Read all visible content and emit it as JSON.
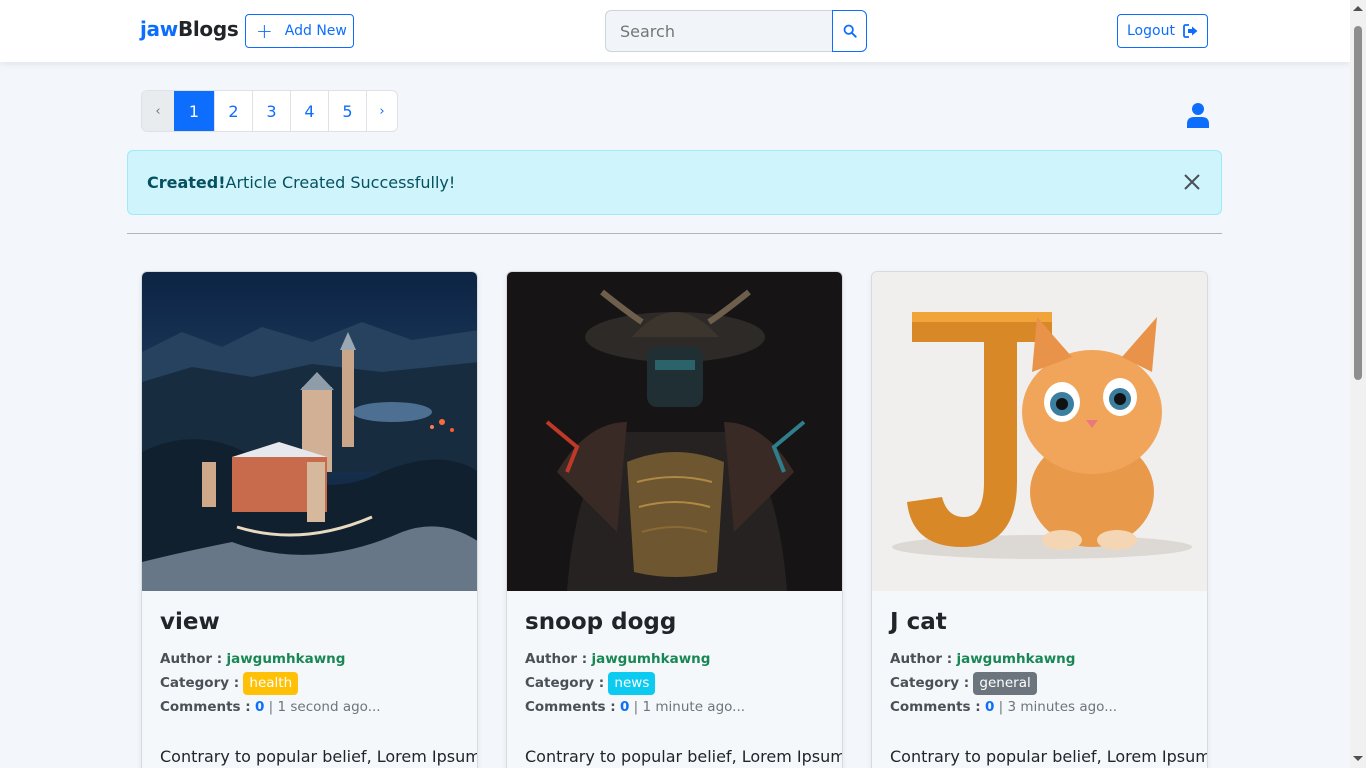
{
  "navbar": {
    "brand_part1": "jaw",
    "brand_part2": "Blogs",
    "add_new_label": "Add New",
    "search_placeholder": "Search",
    "logout_label": "Logout"
  },
  "pagination": {
    "prev": "‹",
    "pages": [
      "1",
      "2",
      "3",
      "4",
      "5"
    ],
    "active_page": "1",
    "next": "›"
  },
  "alert": {
    "title": "Created!",
    "message": "Article Created Successfully!"
  },
  "colors": {
    "primary": "#0d6efd",
    "alert_bg": "#cff4fc",
    "health": "#ffc107",
    "news": "#0dcaf0",
    "general": "#6c757d",
    "author": "#198754"
  },
  "labels": {
    "author": "Author :",
    "category": "Category :",
    "comments": "Comments :"
  },
  "articles": [
    {
      "title": "view",
      "author": "jawgumhkawng",
      "category": "health",
      "comments": "0",
      "time": "| 1 second ago...",
      "excerpt": "Contrary to popular belief, Lorem Ipsum"
    },
    {
      "title": "snoop dogg",
      "author": "jawgumhkawng",
      "category": "news",
      "comments": "0",
      "time": "| 1 minute ago...",
      "excerpt": "Contrary to popular belief, Lorem Ipsum"
    },
    {
      "title": "J cat",
      "author": "jawgumhkawng",
      "category": "general",
      "comments": "0",
      "time": "| 3 minutes ago...",
      "excerpt": "Contrary to popular belief, Lorem Ipsum"
    }
  ]
}
